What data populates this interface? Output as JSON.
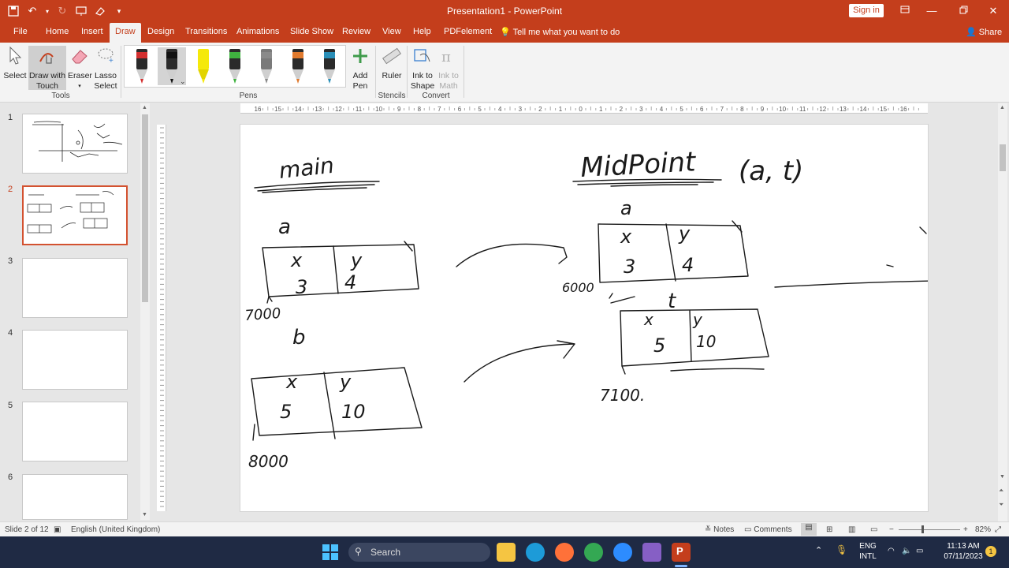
{
  "window": {
    "title": "Presentation1  -  PowerPoint",
    "signin_label": "Sign in"
  },
  "tabs": [
    "File",
    "Home",
    "Insert",
    "Draw",
    "Design",
    "Transitions",
    "Animations",
    "Slide Show",
    "Review",
    "View",
    "Help",
    "PDFelement"
  ],
  "active_tab": "Draw",
  "tell_me": "Tell me what you want to do",
  "share_label": "Share",
  "ribbon": {
    "tools": {
      "select": "Select",
      "draw_touch_1": "Draw with",
      "draw_touch_2": "Touch",
      "eraser": "Eraser",
      "lasso_1": "Lasso",
      "lasso_2": "Select",
      "label": "Tools"
    },
    "pens": {
      "label": "Pens",
      "colors": [
        "#d32f2f",
        "#111111",
        "#f5e90a",
        "#3fb23f",
        "#8a8a8a",
        "#e07a2e",
        "#2a8fb8"
      ]
    },
    "add_pen_1": "Add",
    "add_pen_2": "Pen",
    "ruler": "Ruler",
    "stencils_label": "Stencils",
    "ink_shape_1": "Ink to",
    "ink_shape_2": "Shape",
    "ink_math_1": "Ink to",
    "ink_math_2": "Math",
    "convert_label": "Convert"
  },
  "slides": {
    "numbers": [
      "1",
      "2",
      "3",
      "4",
      "5",
      "6"
    ],
    "active": "2"
  },
  "ruler": {
    "ticks": [
      "16",
      "15",
      "14",
      "13",
      "12",
      "11",
      "10",
      "9",
      "8",
      "7",
      "6",
      "5",
      "4",
      "3",
      "2",
      "1",
      "0",
      "1",
      "2",
      "3",
      "4",
      "5",
      "6",
      "7",
      "8",
      "9",
      "10",
      "11",
      "12",
      "13",
      "14",
      "15",
      "16"
    ]
  },
  "slide_ink": {
    "main": "main",
    "midpoint": "MidPoint",
    "params": "(a, t)",
    "a_label": "a",
    "b_label": "b",
    "t_label": "t",
    "x": "x",
    "y": "y",
    "v3": "3",
    "v4": "4",
    "v5": "5",
    "v10": "10",
    "addr7000": "7000",
    "addr8000": "8000",
    "addr6000": "6000",
    "addr7100": "7100."
  },
  "status": {
    "slide": "Slide 2 of 12",
    "language": "English (United Kingdom)",
    "notes": "Notes",
    "comments": "Comments",
    "zoom": "82%"
  },
  "taskbar": {
    "search": "Search",
    "lang_1": "ENG",
    "lang_2": "INTL",
    "time": "11:13 AM",
    "date": "07/11/2023",
    "notif": "1"
  }
}
